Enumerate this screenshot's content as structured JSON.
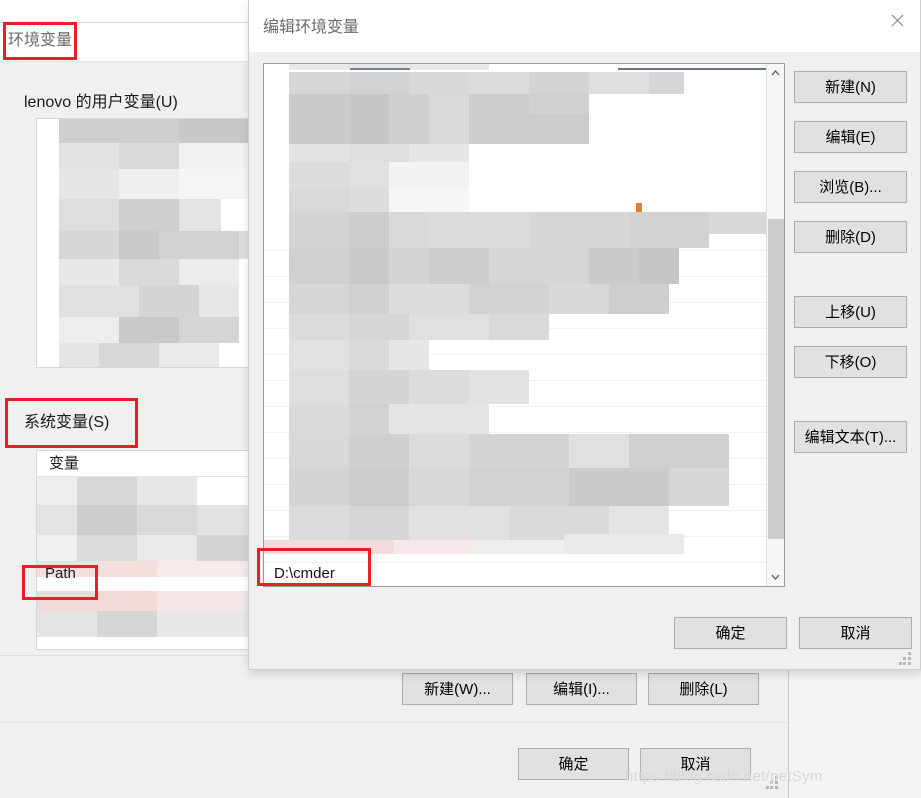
{
  "background_window": {
    "title": "环境变量",
    "user_variables_label": "lenovo 的用户变量(U)",
    "system_variables_label": "系统变量(S)",
    "column_header_variable": "变量",
    "system_rows": [
      "Path"
    ],
    "buttons": {
      "new": "新建(W)...",
      "edit": "编辑(I)...",
      "delete": "删除(L)",
      "ok": "确定",
      "cancel": "取消"
    }
  },
  "dialog": {
    "title": "编辑环境变量",
    "close_icon": "close-icon",
    "list_visible_entry": "D:\\cmder",
    "scrollbar": {
      "up_icon": "chevron-up-icon",
      "down_icon": "chevron-down-icon"
    },
    "side_buttons": {
      "new": "新建(N)",
      "edit": "编辑(E)",
      "browse": "浏览(B)...",
      "delete": "删除(D)",
      "move_up": "上移(U)",
      "move_down": "下移(O)",
      "edit_text": "编辑文本(T)..."
    },
    "footer_buttons": {
      "ok": "确定",
      "cancel": "取消"
    }
  },
  "annotations": {
    "color": "#ee1c25",
    "boxes": [
      "环境变量",
      "系统变量(S)",
      "Path",
      "D:\\cmder"
    ]
  },
  "watermark": {
    "text": "https://blog.csdn.net/petSym"
  }
}
